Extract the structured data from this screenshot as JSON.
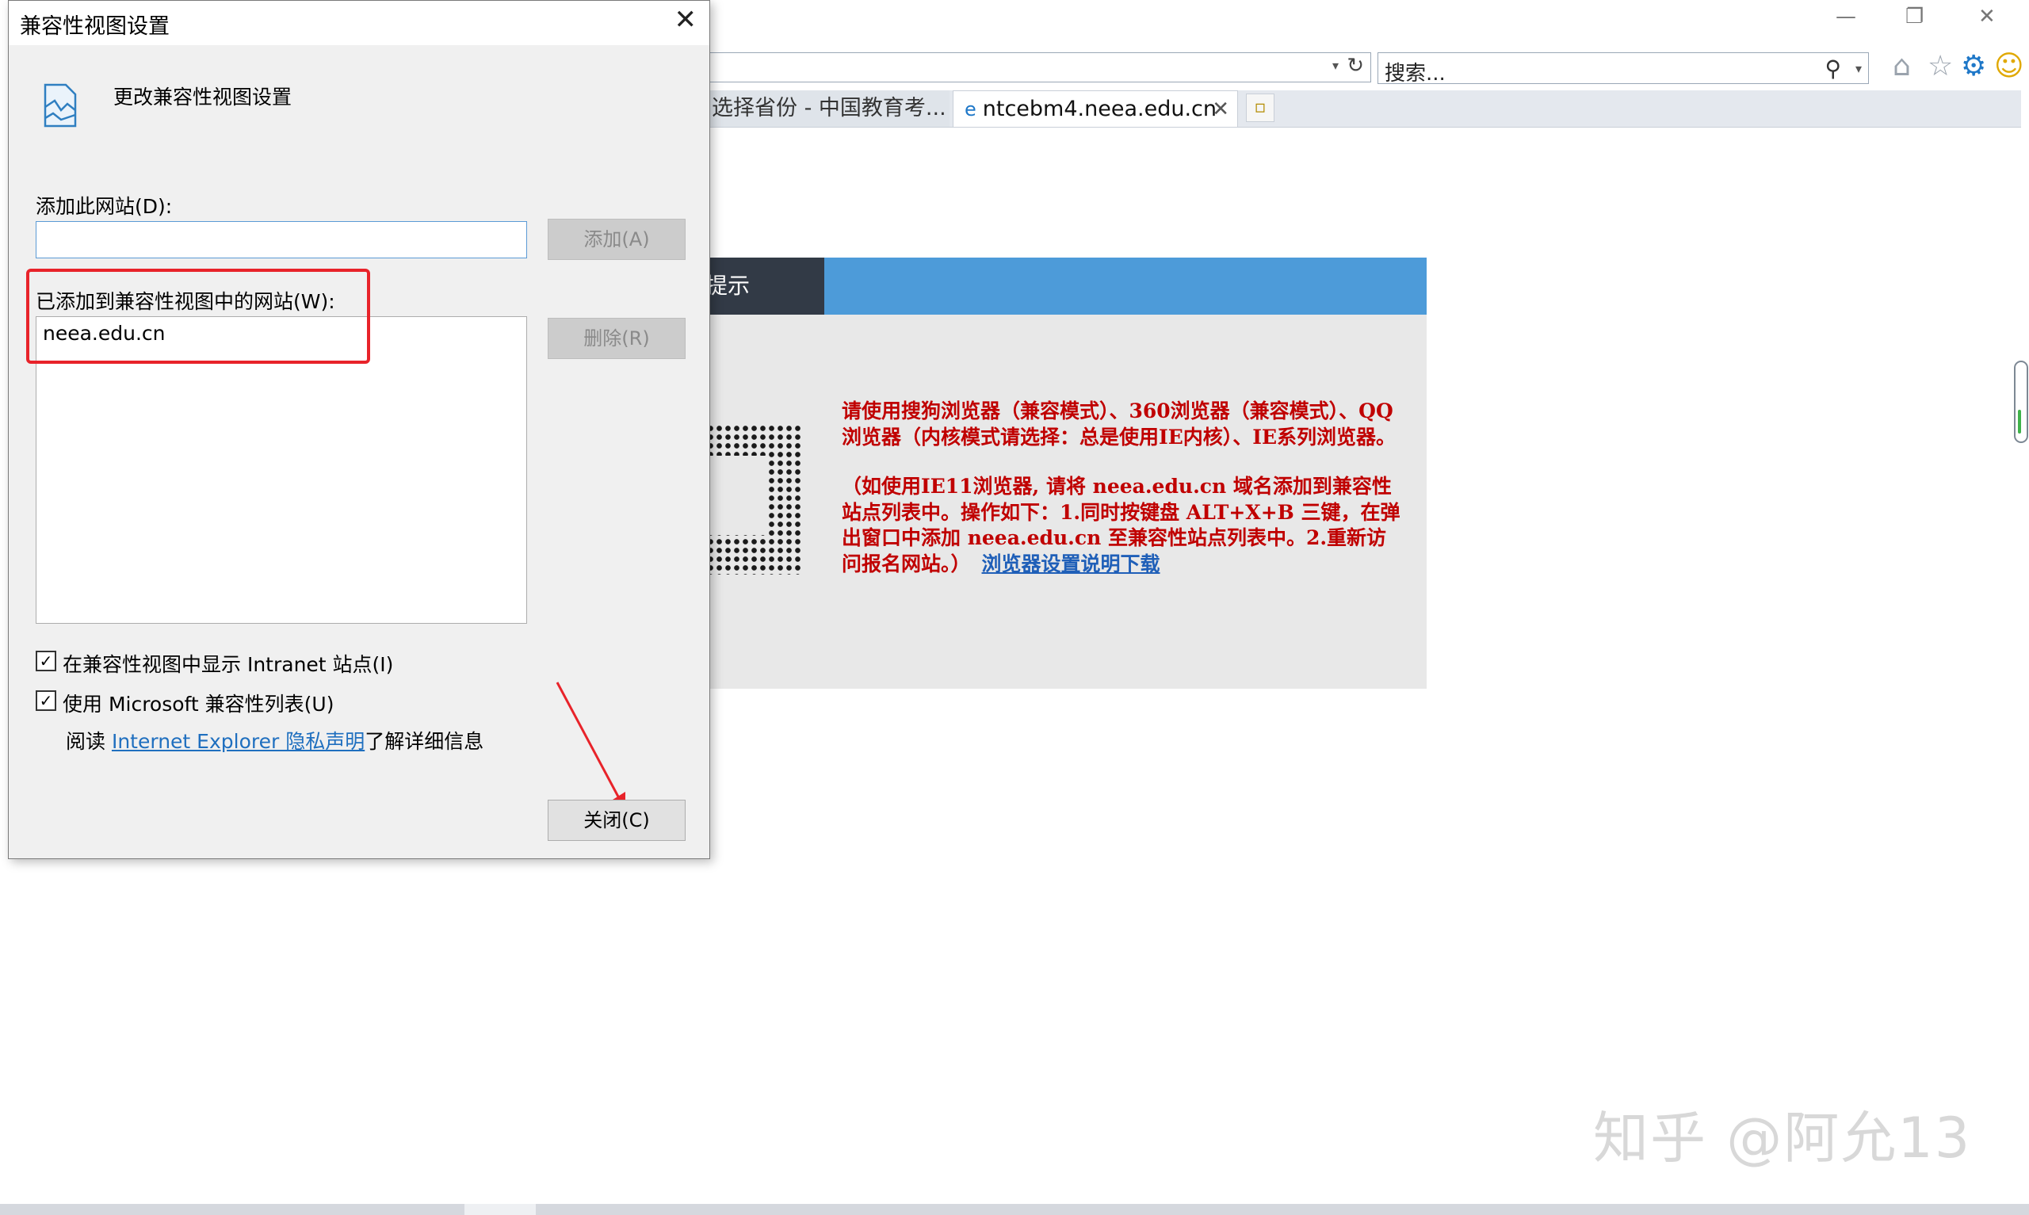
{
  "browser": {
    "window_controls": {
      "minimize": "—",
      "restore": "❐",
      "close": "✕"
    },
    "address_dropdown": "▾",
    "refresh_icon": "↻",
    "search": {
      "placeholder": "搜索...",
      "icon": "⚲",
      "dropdown": "▾"
    },
    "toolbar_icons": {
      "home": "⌂",
      "favorites": "☆",
      "tools": "⚙",
      "feedback": "☺"
    },
    "tabs": [
      {
        "label": "选择省份 - 中国教育考...",
        "active": false
      },
      {
        "label": "ntcebm4.neea.edu.cn",
        "active": true,
        "close": "✕"
      }
    ],
    "new_tab_icon": "▫"
  },
  "page": {
    "notice_title": "提示",
    "paragraph1": "请使用搜狗浏览器（兼容模式）、360浏览器（兼容模式）、QQ浏览器（内核模式请选择：总是使用IE内核）、IE系列浏览器。",
    "paragraph2": "（如使用IE11浏览器, 请将 neea.edu.cn 域名添加到兼容性站点列表中。操作如下：1.同时按键盘 ALT+X+B 三键，在弹出窗口中添加 neea.edu.cn 至兼容性站点列表中。2.重新访问报名网站。）",
    "download_link": "浏览器设置说明下载",
    "watermark": "知乎 @阿允13"
  },
  "dialog": {
    "title": "兼容性视图设置",
    "close": "✕",
    "heading": "更改兼容性视图设置",
    "add_site_label": "添加此网站(D):",
    "add_site_value": "",
    "add_button": "添加(A)",
    "added_sites_label": "已添加到兼容性视图中的网站(W):",
    "added_sites": [
      "neea.edu.cn"
    ],
    "remove_button": "删除(R)",
    "checkbox_intranet": {
      "label": "在兼容性视图中显示 Intranet 站点(I)",
      "checked": true
    },
    "checkbox_mslist": {
      "label": "使用 Microsoft 兼容性列表(U)",
      "checked": true
    },
    "privacy_prefix": "阅读 ",
    "privacy_link": "Internet Explorer 隐私声明",
    "privacy_suffix": "了解详细信息",
    "close_button": "关闭(C)",
    "check_mark": "✓"
  },
  "colors": {
    "highlight_box": "#e8232a",
    "notice_text": "#c00000",
    "link": "#1f6fbf",
    "notice_header_blue": "#4d9bd9",
    "notice_header_dark": "#323a46"
  }
}
